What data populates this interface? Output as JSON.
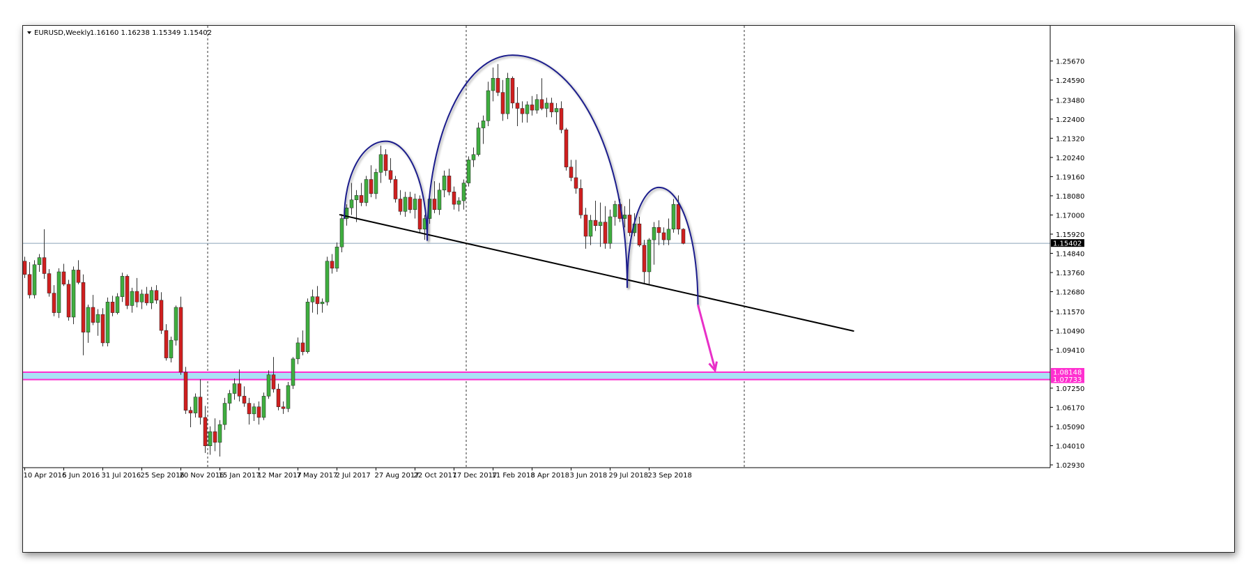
{
  "header": {
    "symbol": "EURUSD,Weekly",
    "ohlc": "1.16160 1.16238 1.15349 1.15402"
  },
  "colors": {
    "bull": "#3fae3f",
    "bear": "#d01f1f",
    "wick": "#333333",
    "arc": "#1a1f8c",
    "trendline": "#000000",
    "zone_fill": "#a9e1f5",
    "zone_line": "#ff2fd0",
    "arrow": "#e830c8",
    "price_line": "#8aa3b8",
    "grid_v": "#333333"
  },
  "chart_data": {
    "type": "candlestick",
    "title": "EURUSD,Weekly",
    "timeframe": "Weekly",
    "current_price": 1.15402,
    "ylim": [
      1.0293,
      1.2667
    ],
    "y_ticks": [
      "1.25670",
      "1.24590",
      "1.23480",
      "1.22400",
      "1.21320",
      "1.20240",
      "1.19160",
      "1.18080",
      "1.17000",
      "1.15920",
      "1.14840",
      "1.13760",
      "1.12680",
      "1.11570",
      "1.10490",
      "1.09410",
      "1.07250",
      "1.06170",
      "1.05090",
      "1.04010",
      "1.02930"
    ],
    "x_ticks": [
      "10 Apr 2016",
      "5 Jun 2016",
      "31 Jul 2016",
      "25 Sep 2016",
      "20 Nov 2016",
      "15 Jan 2017",
      "12 Mar 2017",
      "7 May 2017",
      "2 Jul 2017",
      "27 Aug 2017",
      "22 Oct 2017",
      "17 Dec 2017",
      "11 Feb 2018",
      "8 Apr 2018",
      "3 Jun 2018",
      "29 Jul 2018",
      "23 Sep 2018"
    ],
    "labels": {
      "price": "1.15402",
      "zone_top": "1.08148",
      "zone_bottom": "1.07733"
    },
    "support_zone": {
      "top": 1.08148,
      "bottom": 1.07733
    },
    "pattern": "head and shoulders",
    "neckline": {
      "start": {
        "bar": 64.5,
        "price": 1.1702
      },
      "end": {
        "bar": 170,
        "price": 1.1046
      }
    },
    "projection": {
      "from": {
        "bar": 138,
        "price": 1.1194
      },
      "to": {
        "bar": 141.5,
        "price": 1.0825
      }
    },
    "arcs": [
      {
        "name": "left-shoulder",
        "left": 65.5,
        "right": 82.5,
        "peak_bar": 74,
        "peak": 1.2115,
        "left_base": 1.1678,
        "right_base": 1.1555
      },
      {
        "name": "head",
        "left": 82.5,
        "right": 123.5,
        "peak_bar": 100,
        "peak": 1.26,
        "left_base": 1.1555,
        "right_base": 1.129
      },
      {
        "name": "right-shoulder",
        "left": 123.5,
        "right": 138,
        "peak_bar": 130,
        "peak": 1.1855,
        "left_base": 1.129,
        "right_base": 1.1194
      }
    ],
    "candles": [
      [
        1.144,
        1.1465,
        1.1345,
        1.1365
      ],
      [
        1.1365,
        1.1435,
        1.123,
        1.125
      ],
      [
        1.125,
        1.1445,
        1.123,
        1.142
      ],
      [
        1.142,
        1.148,
        1.138,
        1.146
      ],
      [
        1.146,
        1.162,
        1.134,
        1.137
      ],
      [
        1.137,
        1.1395,
        1.124,
        1.126
      ],
      [
        1.126,
        1.1305,
        1.113,
        1.115
      ],
      [
        1.115,
        1.14,
        1.112,
        1.138
      ],
      [
        1.138,
        1.1425,
        1.13,
        1.131
      ],
      [
        1.131,
        1.1335,
        1.1105,
        1.1125
      ],
      [
        1.1125,
        1.141,
        1.1085,
        1.139
      ],
      [
        1.139,
        1.1445,
        1.131,
        1.132
      ],
      [
        1.132,
        1.1365,
        1.091,
        1.104
      ],
      [
        1.104,
        1.1195,
        1.098,
        1.118
      ],
      [
        1.118,
        1.125,
        1.108,
        1.1095
      ],
      [
        1.1095,
        1.117,
        1.102,
        1.114
      ],
      [
        1.114,
        1.1175,
        1.096,
        1.098
      ],
      [
        1.098,
        1.1235,
        1.096,
        1.121
      ],
      [
        1.121,
        1.1245,
        1.113,
        1.115
      ],
      [
        1.115,
        1.126,
        1.114,
        1.124
      ],
      [
        1.124,
        1.1375,
        1.121,
        1.1355
      ],
      [
        1.1355,
        1.1365,
        1.117,
        1.119
      ],
      [
        1.119,
        1.129,
        1.115,
        1.127
      ],
      [
        1.127,
        1.1345,
        1.118,
        1.121
      ],
      [
        1.121,
        1.128,
        1.117,
        1.1255
      ],
      [
        1.1255,
        1.1295,
        1.119,
        1.1205
      ],
      [
        1.1205,
        1.1295,
        1.117,
        1.1275
      ],
      [
        1.1275,
        1.1305,
        1.12,
        1.122
      ],
      [
        1.122,
        1.1265,
        1.103,
        1.105
      ],
      [
        1.105,
        1.1085,
        1.088,
        1.0895
      ],
      [
        1.0895,
        1.1015,
        1.087,
        1.0995
      ],
      [
        1.0995,
        1.119,
        1.0965,
        1.118
      ],
      [
        1.118,
        1.124,
        1.08,
        1.0815
      ],
      [
        1.0815,
        1.0845,
        1.058,
        1.06
      ],
      [
        1.06,
        1.062,
        1.0505,
        1.0585
      ],
      [
        1.0585,
        1.0695,
        1.056,
        1.0675
      ],
      [
        1.0675,
        1.0775,
        1.052,
        1.056
      ],
      [
        1.056,
        1.0625,
        1.036,
        1.04
      ],
      [
        1.04,
        1.051,
        1.035,
        1.048
      ],
      [
        1.048,
        1.0555,
        1.037,
        1.042
      ],
      [
        1.042,
        1.0545,
        1.034,
        1.052
      ],
      [
        1.052,
        1.067,
        1.049,
        1.064
      ],
      [
        1.064,
        1.0715,
        1.06,
        1.0695
      ],
      [
        1.0695,
        1.078,
        1.066,
        1.075
      ],
      [
        1.075,
        1.083,
        1.065,
        1.068
      ],
      [
        1.068,
        1.0735,
        1.062,
        1.064
      ],
      [
        1.064,
        1.067,
        1.052,
        1.058
      ],
      [
        1.058,
        1.064,
        1.054,
        1.062
      ],
      [
        1.062,
        1.065,
        1.052,
        1.056
      ],
      [
        1.056,
        1.07,
        1.0545,
        1.068
      ],
      [
        1.068,
        1.0825,
        1.0665,
        1.08
      ],
      [
        1.08,
        1.09,
        1.07,
        1.072
      ],
      [
        1.072,
        1.075,
        1.06,
        1.062
      ],
      [
        1.062,
        1.065,
        1.058,
        1.061
      ],
      [
        1.061,
        1.076,
        1.059,
        1.074
      ],
      [
        1.074,
        1.09,
        1.072,
        1.089
      ],
      [
        1.089,
        1.101,
        1.086,
        1.098
      ],
      [
        1.098,
        1.105,
        1.091,
        1.093
      ],
      [
        1.093,
        1.123,
        1.092,
        1.121
      ],
      [
        1.121,
        1.128,
        1.115,
        1.124
      ],
      [
        1.124,
        1.13,
        1.114,
        1.12
      ],
      [
        1.12,
        1.123,
        1.115,
        1.121
      ],
      [
        1.121,
        1.1465,
        1.119,
        1.144
      ],
      [
        1.144,
        1.148,
        1.137,
        1.14
      ],
      [
        1.14,
        1.1545,
        1.138,
        1.152
      ],
      [
        1.152,
        1.1705,
        1.149,
        1.168
      ],
      [
        1.168,
        1.176,
        1.164,
        1.174
      ],
      [
        1.174,
        1.188,
        1.17,
        1.1785
      ],
      [
        1.1785,
        1.184,
        1.166,
        1.181
      ],
      [
        1.181,
        1.188,
        1.175,
        1.177
      ],
      [
        1.177,
        1.192,
        1.175,
        1.19
      ],
      [
        1.19,
        1.198,
        1.18,
        1.182
      ],
      [
        1.182,
        1.196,
        1.179,
        1.194
      ],
      [
        1.194,
        1.209,
        1.188,
        1.204
      ],
      [
        1.204,
        1.207,
        1.192,
        1.195
      ],
      [
        1.195,
        1.202,
        1.188,
        1.19
      ],
      [
        1.19,
        1.192,
        1.177,
        1.179
      ],
      [
        1.179,
        1.184,
        1.17,
        1.172
      ],
      [
        1.172,
        1.183,
        1.169,
        1.18
      ],
      [
        1.18,
        1.183,
        1.171,
        1.173
      ],
      [
        1.173,
        1.182,
        1.168,
        1.179
      ],
      [
        1.179,
        1.181,
        1.16,
        1.162
      ],
      [
        1.162,
        1.17,
        1.156,
        1.168
      ],
      [
        1.168,
        1.182,
        1.165,
        1.179
      ],
      [
        1.179,
        1.189,
        1.171,
        1.173
      ],
      [
        1.173,
        1.188,
        1.17,
        1.184
      ],
      [
        1.184,
        1.195,
        1.18,
        1.192
      ],
      [
        1.192,
        1.196,
        1.181,
        1.183
      ],
      [
        1.183,
        1.186,
        1.173,
        1.176
      ],
      [
        1.176,
        1.18,
        1.172,
        1.178
      ],
      [
        1.178,
        1.19,
        1.173,
        1.188
      ],
      [
        1.188,
        1.203,
        1.186,
        1.201
      ],
      [
        1.201,
        1.208,
        1.197,
        1.204
      ],
      [
        1.204,
        1.222,
        1.203,
        1.219
      ],
      [
        1.219,
        1.226,
        1.21,
        1.223
      ],
      [
        1.223,
        1.245,
        1.22,
        1.24
      ],
      [
        1.24,
        1.253,
        1.234,
        1.247
      ],
      [
        1.247,
        1.255,
        1.237,
        1.239
      ],
      [
        1.239,
        1.246,
        1.223,
        1.227
      ],
      [
        1.227,
        1.25,
        1.224,
        1.247
      ],
      [
        1.247,
        1.248,
        1.23,
        1.233
      ],
      [
        1.233,
        1.242,
        1.22,
        1.23
      ],
      [
        1.23,
        1.234,
        1.222,
        1.227
      ],
      [
        1.227,
        1.234,
        1.222,
        1.232
      ],
      [
        1.232,
        1.237,
        1.226,
        1.229
      ],
      [
        1.229,
        1.238,
        1.227,
        1.235
      ],
      [
        1.235,
        1.247,
        1.229,
        1.23
      ],
      [
        1.23,
        1.236,
        1.225,
        1.233
      ],
      [
        1.233,
        1.236,
        1.225,
        1.228
      ],
      [
        1.228,
        1.233,
        1.221,
        1.23
      ],
      [
        1.23,
        1.234,
        1.216,
        1.218
      ],
      [
        1.218,
        1.219,
        1.195,
        1.197
      ],
      [
        1.197,
        1.201,
        1.189,
        1.191
      ],
      [
        1.191,
        1.201,
        1.182,
        1.185
      ],
      [
        1.185,
        1.19,
        1.168,
        1.17
      ],
      [
        1.17,
        1.174,
        1.151,
        1.158
      ],
      [
        1.158,
        1.17,
        1.153,
        1.167
      ],
      [
        1.167,
        1.178,
        1.161,
        1.164
      ],
      [
        1.164,
        1.177,
        1.152,
        1.166
      ],
      [
        1.166,
        1.175,
        1.151,
        1.154
      ],
      [
        1.154,
        1.173,
        1.151,
        1.169
      ],
      [
        1.169,
        1.178,
        1.164,
        1.176
      ],
      [
        1.176,
        1.179,
        1.166,
        1.168
      ],
      [
        1.168,
        1.175,
        1.163,
        1.17
      ],
      [
        1.17,
        1.179,
        1.158,
        1.16
      ],
      [
        1.16,
        1.171,
        1.158,
        1.165
      ],
      [
        1.165,
        1.169,
        1.152,
        1.153
      ],
      [
        1.153,
        1.156,
        1.131,
        1.138
      ],
      [
        1.138,
        1.157,
        1.131,
        1.156
      ],
      [
        1.156,
        1.166,
        1.142,
        1.163
      ],
      [
        1.163,
        1.167,
        1.153,
        1.16
      ],
      [
        1.16,
        1.163,
        1.153,
        1.156
      ],
      [
        1.156,
        1.168,
        1.153,
        1.162
      ],
      [
        1.162,
        1.179,
        1.16,
        1.176
      ],
      [
        1.176,
        1.181,
        1.159,
        1.162
      ],
      [
        1.162,
        1.1625,
        1.1535,
        1.154
      ]
    ]
  }
}
